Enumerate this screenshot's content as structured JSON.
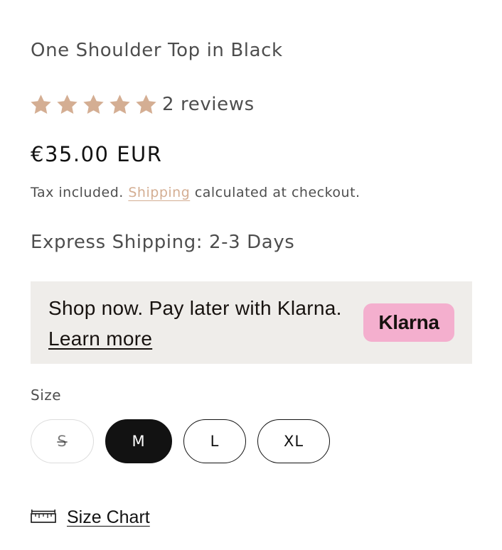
{
  "product": {
    "title": "One Shoulder Top in Black",
    "rating": {
      "stars": 5,
      "max": 5,
      "reviews_label": "2 reviews",
      "star_color": "#d4ae93"
    },
    "price": "€35.00 EUR",
    "tax_note": {
      "before": "Tax included.",
      "link": "Shipping",
      "after": "calculated at checkout."
    },
    "express_shipping": "Express Shipping: 2-3 Days"
  },
  "klarna": {
    "text": "Shop now. Pay later with Klarna.",
    "learn_more": "Learn more",
    "badge": "Klarna",
    "badge_color": "#f4afce",
    "background": "#efedea"
  },
  "size": {
    "label": "Size",
    "options": [
      {
        "label": "S",
        "state": "unavailable"
      },
      {
        "label": "M",
        "state": "selected"
      },
      {
        "label": "L",
        "state": "available"
      },
      {
        "label": "XL",
        "state": "available"
      }
    ]
  },
  "size_chart": {
    "label": "Size Chart",
    "icon": "ruler-icon"
  }
}
